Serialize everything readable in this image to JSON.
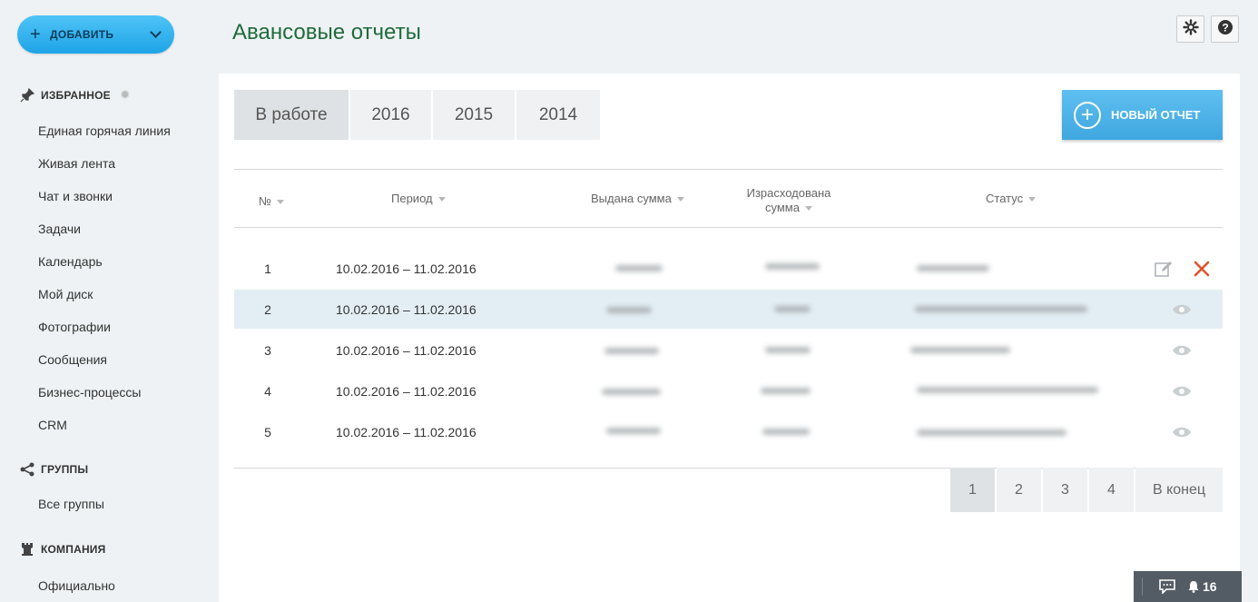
{
  "sidebar": {
    "add_button": "ДОБАВИТЬ",
    "sections": [
      {
        "title": "ИЗБРАННОЕ",
        "items": [
          "Единая горячая линия",
          "Живая лента",
          "Чат и звонки",
          "Задачи",
          "Календарь",
          "Мой диск",
          "Фотографии",
          "Сообщения",
          "Бизнес-процессы",
          "CRM"
        ]
      },
      {
        "title": "ГРУППЫ",
        "items": [
          "Все группы"
        ]
      },
      {
        "title": "КОМПАНИЯ",
        "items": [
          "Официально"
        ]
      }
    ]
  },
  "header": {
    "title": "Авансовые отчеты"
  },
  "tabs": [
    "В работе",
    "2016",
    "2015",
    "2014"
  ],
  "new_report_button": "НОВЫЙ ОТЧЕТ",
  "table": {
    "columns": [
      "№",
      "Период",
      "Выдана сумма",
      "Израсходована сумма",
      "Статус"
    ],
    "rows": [
      {
        "num": "1",
        "period": "10.02.2016 – 11.02.2016",
        "actions": [
          "edit-icon",
          "delete-icon"
        ]
      },
      {
        "num": "2",
        "period": "10.02.2016 – 11.02.2016",
        "actions": [
          "eye-icon"
        ]
      },
      {
        "num": "3",
        "period": "10.02.2016 – 11.02.2016",
        "actions": [
          "eye-icon"
        ]
      },
      {
        "num": "4",
        "period": "10.02.2016 – 11.02.2016",
        "actions": [
          "eye-icon"
        ]
      },
      {
        "num": "5",
        "period": "10.02.2016 – 11.02.2016",
        "actions": [
          "eye-icon"
        ]
      }
    ]
  },
  "pagination": {
    "pages": [
      "1",
      "2",
      "3",
      "4"
    ],
    "last_label": "В конец",
    "current": "1"
  },
  "bottom_bar": {
    "notifications": "16"
  },
  "colors": {
    "title": "#1f6b3a",
    "accent": "#3fa7e0",
    "highlight_row": "#e3eef4",
    "delete": "#e0522b"
  }
}
